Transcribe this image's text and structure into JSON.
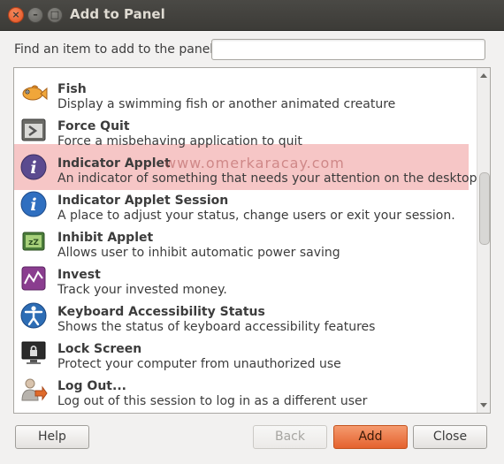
{
  "window": {
    "title": "Add to Panel"
  },
  "search": {
    "label": "Find an item to add to the panel:",
    "value": "",
    "placeholder": ""
  },
  "items": [
    {
      "name": "Fish",
      "description": "Display a swimming fish or another animated creature",
      "icon": "fish-icon"
    },
    {
      "name": "Force Quit",
      "description": "Force a misbehaving application to quit",
      "icon": "force-quit-icon"
    },
    {
      "name": "Indicator Applet",
      "description": "An indicator of something that needs your attention on the desktop",
      "icon": "info-icon",
      "highlighted": true
    },
    {
      "name": "Indicator Applet Session",
      "description": "A place to adjust your status, change users or exit your session.",
      "icon": "info-icon"
    },
    {
      "name": "Inhibit Applet",
      "description": "Allows user to inhibit automatic power saving",
      "icon": "inhibit-icon"
    },
    {
      "name": "Invest",
      "description": "Track your invested money.",
      "icon": "invest-icon"
    },
    {
      "name": "Keyboard Accessibility Status",
      "description": "Shows the status of keyboard accessibility features",
      "icon": "accessibility-icon"
    },
    {
      "name": "Lock Screen",
      "description": "Protect your computer from unauthorized use",
      "icon": "lock-screen-icon"
    },
    {
      "name": "Log Out...",
      "description": "Log out of this session to log in as a different user",
      "icon": "log-out-icon"
    }
  ],
  "watermark": "www.omerkaracay.com",
  "buttons": {
    "help": "Help",
    "back": "Back",
    "add": "Add",
    "close": "Close"
  },
  "colors": {
    "highlight": "#e86a6a",
    "add_button": "#e4622e",
    "titlebar": "#3c3b37"
  }
}
